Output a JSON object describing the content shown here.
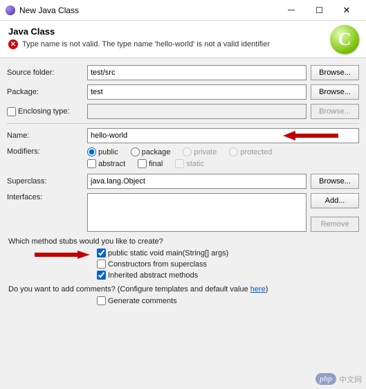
{
  "window": {
    "title": "New Java Class"
  },
  "header": {
    "title": "Java Class",
    "error": "Type name is not valid. The type name 'hello-world' is not a valid identifier",
    "banner_glyph": "C"
  },
  "labels": {
    "source_folder": "Source folder:",
    "package": "Package:",
    "enclosing": "Enclosing type:",
    "name": "Name:",
    "modifiers": "Modifiers:",
    "superclass": "Superclass:",
    "interfaces": "Interfaces:"
  },
  "fields": {
    "source_folder": "test/src",
    "package": "test",
    "enclosing": "",
    "name": "hello-world",
    "superclass": "java.lang.Object"
  },
  "buttons": {
    "browse": "Browse...",
    "add": "Add...",
    "remove": "Remove"
  },
  "modifiers": {
    "public": "public",
    "package": "package",
    "private": "private",
    "protected": "protected",
    "abstract": "abstract",
    "final": "final",
    "static": "static"
  },
  "stubs": {
    "question": "Which method stubs would you like to create?",
    "main": "public static void main(String[] args)",
    "constructors": "Constructors from superclass",
    "inherited": "Inherited abstract methods"
  },
  "comments": {
    "question_pre": "Do you want to add comments? (Configure templates and default value ",
    "link": "here",
    "question_post": ")",
    "generate": "Generate comments"
  },
  "watermark": {
    "php": "php",
    "cn": "中文网"
  }
}
